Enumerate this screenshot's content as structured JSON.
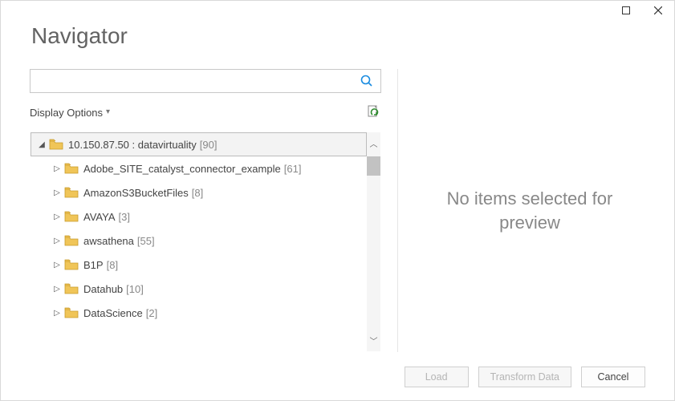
{
  "window": {
    "title": "Navigator"
  },
  "search": {
    "value": "",
    "placeholder": ""
  },
  "display_options": {
    "label": "Display Options"
  },
  "tree": {
    "root": {
      "label": "10.150.87.50 : datavirtuality",
      "count": 90
    },
    "children": [
      {
        "label": "Adobe_SITE_catalyst_connector_example",
        "count": 61
      },
      {
        "label": "AmazonS3BucketFiles",
        "count": 8
      },
      {
        "label": "AVAYA",
        "count": 3
      },
      {
        "label": "awsathena",
        "count": 55
      },
      {
        "label": "B1P",
        "count": 8
      },
      {
        "label": "Datahub",
        "count": 10
      },
      {
        "label": "DataScience",
        "count": 2
      }
    ]
  },
  "preview": {
    "empty_message_line1": "No items selected for",
    "empty_message_line2": "preview"
  },
  "footer": {
    "load": "Load",
    "transform": "Transform Data",
    "cancel": "Cancel"
  }
}
